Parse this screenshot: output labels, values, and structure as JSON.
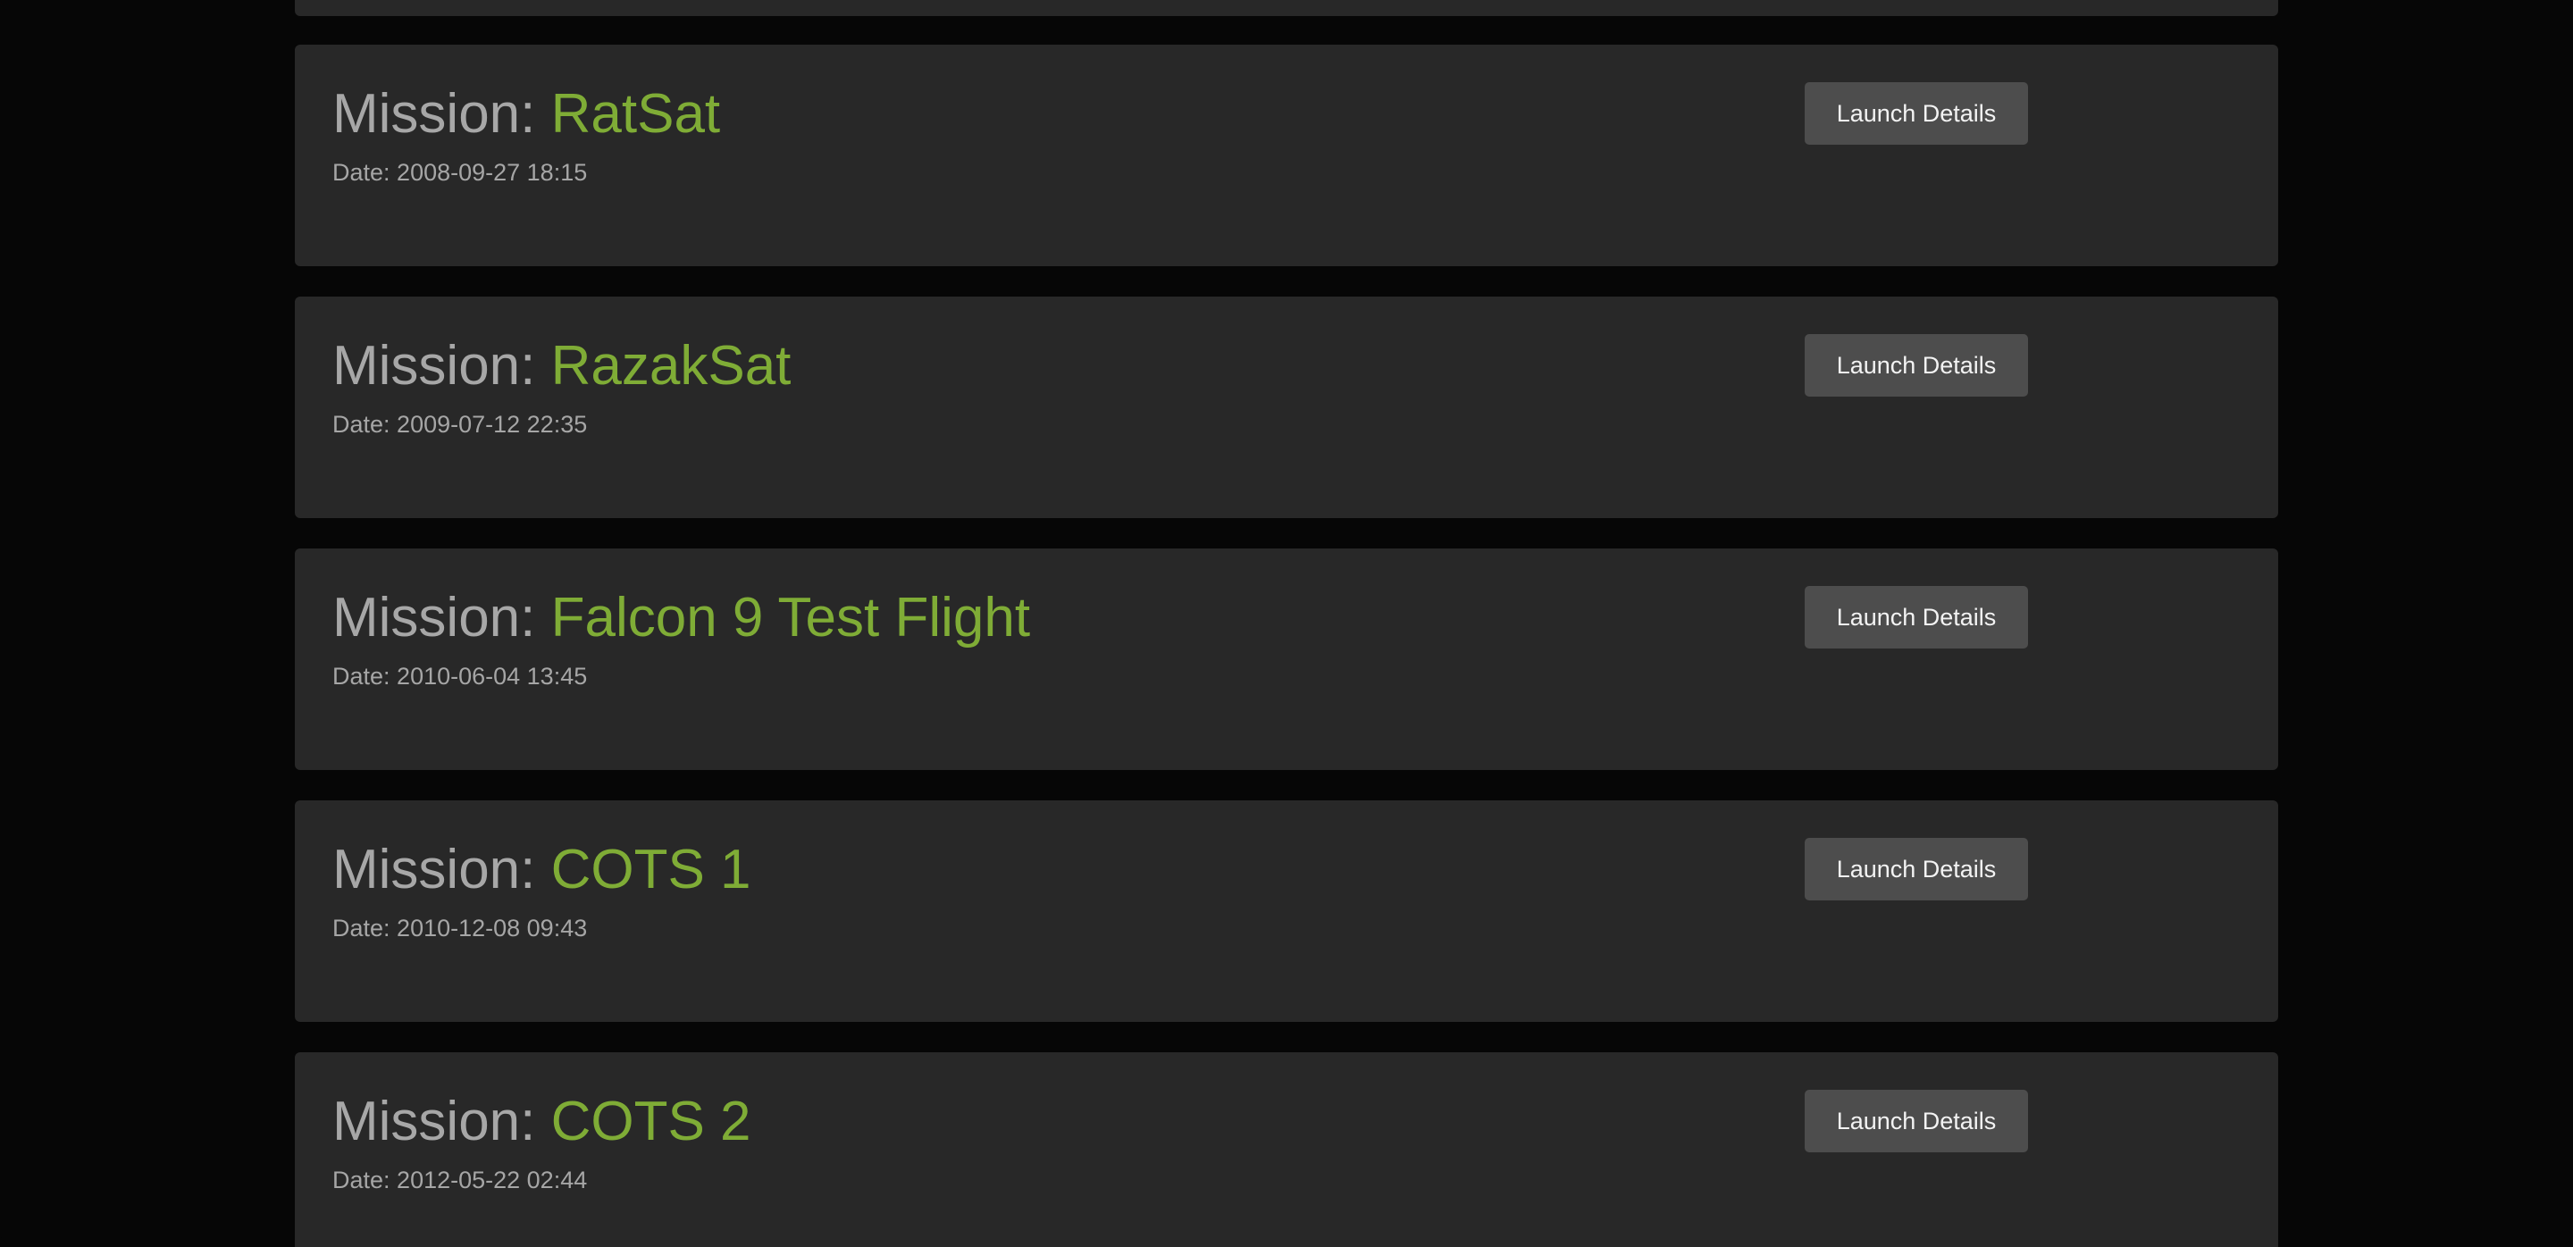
{
  "mission_prefix": "Mission: ",
  "date_prefix": "Date: ",
  "button_label": "Launch Details",
  "colors": {
    "background": "#060606",
    "card": "#282828",
    "mission_name": "#7fac36",
    "prefix_text": "#a7a7a7",
    "button": "#4d4d4d"
  },
  "missions": [
    {
      "name": "RatSat",
      "date": "2008-09-27 18:15"
    },
    {
      "name": "RazakSat",
      "date": "2009-07-12 22:35"
    },
    {
      "name": "Falcon 9 Test Flight",
      "date": "2010-06-04 13:45"
    },
    {
      "name": "COTS 1",
      "date": "2010-12-08 09:43"
    },
    {
      "name": "COTS 2",
      "date": "2012-05-22 02:44"
    }
  ]
}
